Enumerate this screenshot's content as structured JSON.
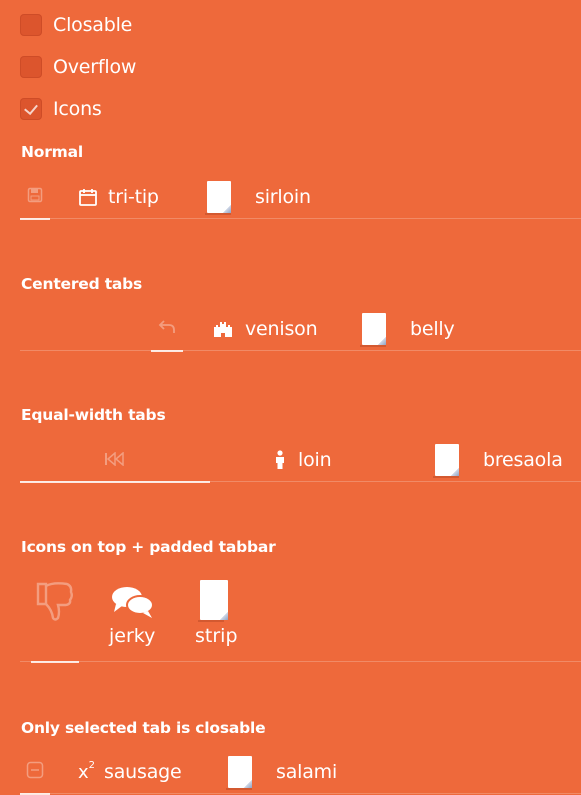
{
  "options": [
    {
      "label": "Closable",
      "checked": false
    },
    {
      "label": "Overflow",
      "checked": false
    },
    {
      "label": "Icons",
      "checked": true
    }
  ],
  "sections": {
    "normal": {
      "title": "Normal",
      "tabs": [
        {
          "icon": "save-icon",
          "label": ""
        },
        {
          "icon": "calendar-icon",
          "label": "tri-tip"
        },
        {
          "icon": "document-icon",
          "label": "sirloin"
        }
      ]
    },
    "centered": {
      "title": "Centered tabs",
      "tabs": [
        {
          "icon": "undo-icon",
          "label": ""
        },
        {
          "icon": "castle-icon",
          "label": "venison"
        },
        {
          "icon": "document-icon",
          "label": "belly"
        }
      ]
    },
    "equal": {
      "title": "Equal-width tabs",
      "tabs": [
        {
          "icon": "skip-back-icon",
          "label": ""
        },
        {
          "icon": "person-icon",
          "label": "loin"
        },
        {
          "icon": "document-icon",
          "label": "bresaola"
        }
      ]
    },
    "icons_top": {
      "title": "Icons on top + padded tabbar",
      "tabs": [
        {
          "icon": "thumbs-down-icon",
          "label": ""
        },
        {
          "icon": "comments-icon",
          "label": "jerky"
        },
        {
          "icon": "document-icon",
          "label": "strip"
        }
      ]
    },
    "only_selected": {
      "title": "Only selected tab is closable",
      "tabs": [
        {
          "icon": "minus-square-icon",
          "label": ""
        },
        {
          "icon": "superscript-icon",
          "label": "sausage"
        },
        {
          "icon": "document-icon",
          "label": "salami"
        }
      ]
    }
  },
  "colors": {
    "background": "#ee693b",
    "text": "#ffffff"
  }
}
